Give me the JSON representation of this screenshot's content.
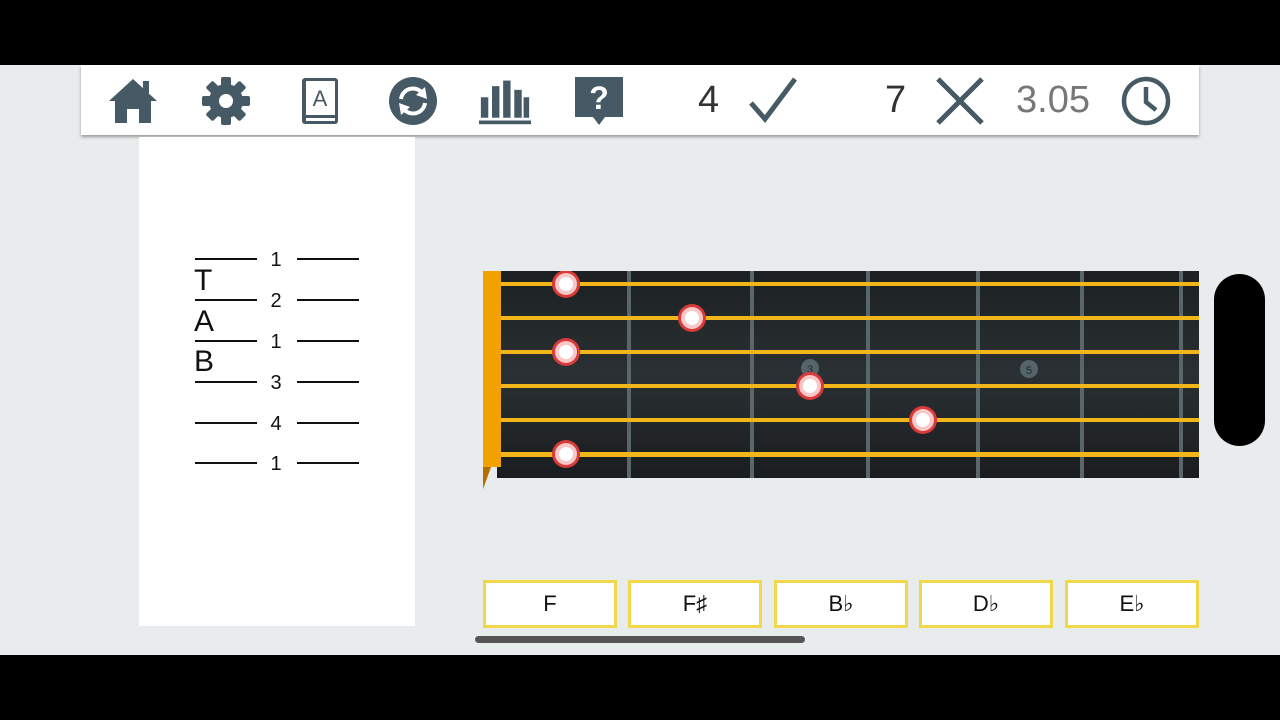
{
  "toolbar": {
    "icons": [
      "home-icon",
      "gear-icon",
      "book-icon",
      "refresh-icon",
      "stats-icon",
      "help-icon"
    ],
    "correct_count": "4",
    "wrong_count": "7",
    "time": "3.05",
    "icon_color": "#455a64"
  },
  "tab": {
    "letters": [
      "T",
      "A",
      "B"
    ],
    "strings": [
      "1",
      "2",
      "1",
      "3",
      "4",
      "1"
    ]
  },
  "fretboard": {
    "fret_markers": [
      "3",
      "5"
    ],
    "string_color": "#f2b51a",
    "nut_color": "#f2a200",
    "note_positions": [
      {
        "string": 1,
        "fret": 1
      },
      {
        "string": 2,
        "fret": 2
      },
      {
        "string": 3,
        "fret": 1
      },
      {
        "string": 4,
        "fret": 3
      },
      {
        "string": 5,
        "fret": 4
      },
      {
        "string": 6,
        "fret": 1
      }
    ]
  },
  "answers": [
    "F",
    "F♯",
    "B♭",
    "D♭",
    "E♭"
  ]
}
